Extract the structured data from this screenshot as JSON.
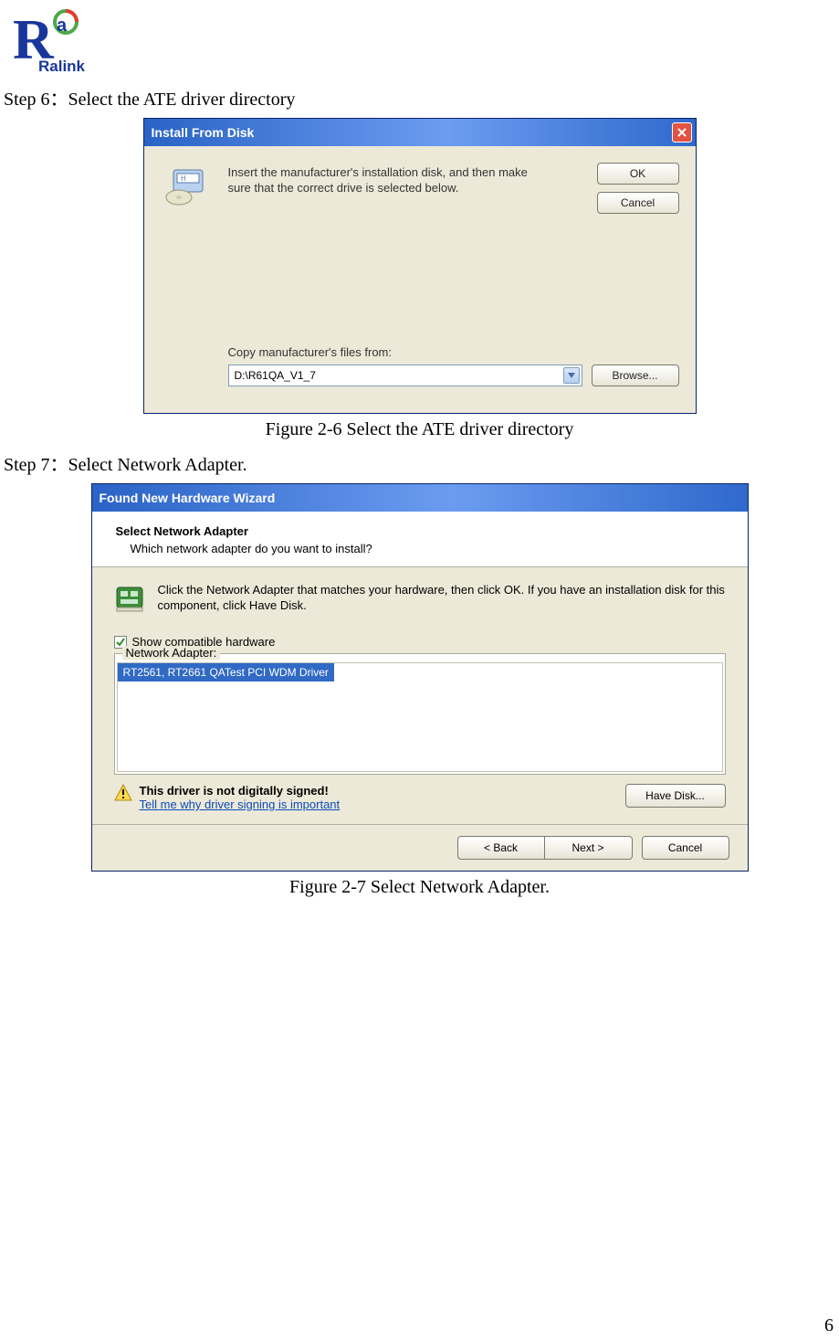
{
  "logo_text": "Ralink",
  "step6": "Step 6：Select the ATE driver directory",
  "step7": "Step 7：Select Network Adapter.",
  "caption1": "Figure 2-6 Select the ATE driver directory",
  "caption2": "Figure 2-7 Select Network Adapter.",
  "page_number": "6",
  "dlg1": {
    "title": "Install From Disk",
    "instruction": "Insert the manufacturer's installation disk, and then make sure that the correct drive is selected below.",
    "ok": "OK",
    "cancel": "Cancel",
    "files_from_label": "Copy manufacturer's files from:",
    "path": "D:\\R61QA_V1_7",
    "browse": "Browse..."
  },
  "dlg2": {
    "title": "Found New Hardware Wizard",
    "header_title": "Select Network Adapter",
    "header_sub": "Which network adapter do you want to install?",
    "nic_text": "Click the Network Adapter that matches your hardware, then click OK. If you have an installation disk for this component, click Have Disk.",
    "show_compat": "Show compatible hardware",
    "group_label": "Network Adapter:",
    "list_item": "RT2561, RT2661 QATest PCI WDM Driver",
    "warn_title": "This driver is not digitally signed!",
    "warn_link": "Tell me why driver signing is important",
    "have_disk": "Have Disk...",
    "back": "< Back",
    "next": "Next >",
    "cancel": "Cancel"
  }
}
